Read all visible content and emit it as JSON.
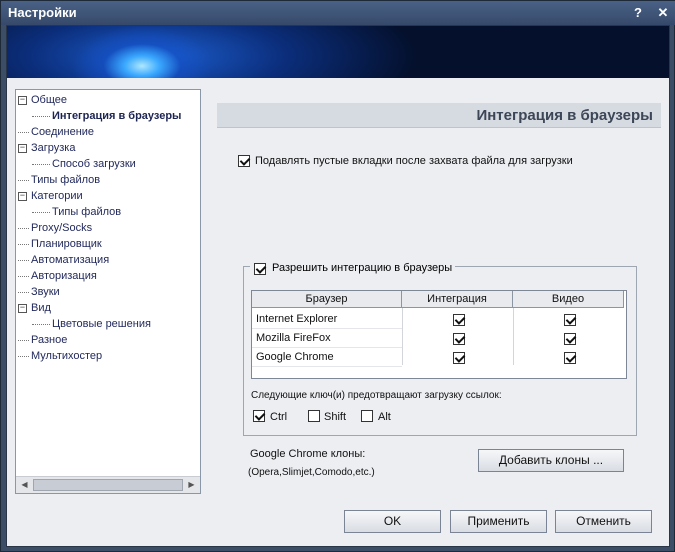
{
  "window": {
    "title": "Настройки",
    "help": "?",
    "close": "✕"
  },
  "tree": {
    "items": [
      {
        "label": "Общее",
        "expander": "−"
      },
      {
        "label": "Интеграция в браузеры"
      },
      {
        "label": "Соединение"
      },
      {
        "label": "Загрузка",
        "expander": "−"
      },
      {
        "label": "Способ загрузки"
      },
      {
        "label": "Типы файлов"
      },
      {
        "label": "Категории",
        "expander": "−"
      },
      {
        "label": "Типы файлов"
      },
      {
        "label": "Proxy/Socks"
      },
      {
        "label": "Планировщик"
      },
      {
        "label": "Автоматизация"
      },
      {
        "label": "Авторизация"
      },
      {
        "label": "Звуки"
      },
      {
        "label": "Вид",
        "expander": "−"
      },
      {
        "label": "Цветовые решения"
      },
      {
        "label": "Разное"
      },
      {
        "label": "Мультихостер"
      }
    ],
    "selected_index": 1,
    "scroll_left": "◀",
    "scroll_right": "▶"
  },
  "section": {
    "title": "Интеграция в браузеры"
  },
  "options": {
    "suppress_empty_tabs": {
      "label": "Подавлять пустые вкладки после захвата файла для загрузки",
      "checked": true
    },
    "allow_integration": {
      "label": "Разрешить интеграцию в браузеры",
      "checked": true
    }
  },
  "browsers_table": {
    "columns": [
      "Браузер",
      "Интеграция",
      "Видео"
    ],
    "rows": [
      {
        "name": "Internet Explorer",
        "integration": true,
        "video": true
      },
      {
        "name": "Mozilla FireFox",
        "integration": true,
        "video": true
      },
      {
        "name": "Google Chrome",
        "integration": true,
        "video": true
      }
    ]
  },
  "keys": {
    "label": "Следующие ключ(и) предотвращают загрузку ссылок:",
    "items": [
      {
        "label": "Ctrl",
        "checked": true
      },
      {
        "label": "Shift",
        "checked": false
      },
      {
        "label": "Alt",
        "checked": false
      }
    ]
  },
  "chrome_clones": {
    "label": "Google Chrome клоны:",
    "hint": "(Opera,Slimjet,Comodo,etc.)",
    "add_button": "Добавить клоны ..."
  },
  "footer": {
    "ok": "OK",
    "apply": "Применить",
    "cancel": "Отменить"
  }
}
